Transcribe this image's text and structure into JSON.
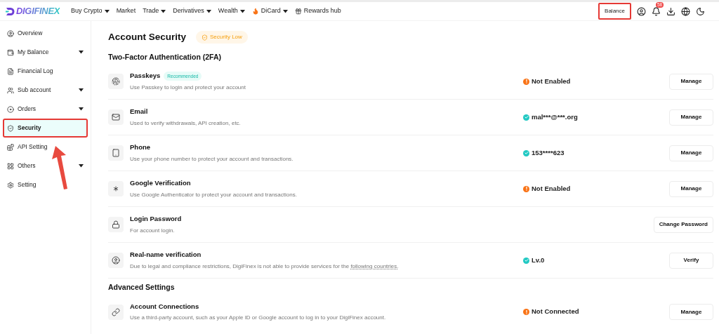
{
  "header": {
    "logo": "DIGIFINEX",
    "nav": [
      {
        "label": "Buy Crypto",
        "dropdown": true,
        "kind": "plain"
      },
      {
        "label": "Market",
        "dropdown": false,
        "kind": "plain"
      },
      {
        "label": "Trade",
        "dropdown": true,
        "kind": "plain"
      },
      {
        "label": "Derivatives",
        "dropdown": true,
        "kind": "plain"
      },
      {
        "label": "Wealth",
        "dropdown": true,
        "kind": "plain"
      },
      {
        "label": "DiCard",
        "dropdown": true,
        "kind": "flame"
      },
      {
        "label": "Rewards hub",
        "dropdown": false,
        "kind": "gift"
      }
    ],
    "balance": {
      "label": "Balance",
      "annotated": true
    },
    "notification_count": "58"
  },
  "sidebar": {
    "items": [
      {
        "label": "Overview",
        "kind": "user",
        "dropdown": false,
        "selected": false,
        "annotated": false
      },
      {
        "label": "My Balance",
        "kind": "wallet",
        "dropdown": true,
        "selected": false,
        "annotated": false
      },
      {
        "label": "Financial Log",
        "kind": "file",
        "dropdown": false,
        "selected": false,
        "annotated": false
      },
      {
        "label": "Sub account",
        "kind": "users",
        "dropdown": true,
        "selected": false,
        "annotated": false
      },
      {
        "label": "Orders",
        "kind": "orders",
        "dropdown": true,
        "selected": false,
        "annotated": false
      },
      {
        "label": "Security",
        "kind": "shield",
        "dropdown": false,
        "selected": true,
        "annotated": true
      },
      {
        "label": "API Setting",
        "kind": "api",
        "dropdown": false,
        "selected": false,
        "annotated": false
      },
      {
        "label": "Others",
        "kind": "grid",
        "dropdown": true,
        "selected": false,
        "annotated": false
      },
      {
        "label": "Setting",
        "kind": "setting",
        "dropdown": false,
        "selected": false,
        "annotated": false
      }
    ]
  },
  "main": {
    "title": "Account Security",
    "security_badge": "Security Low",
    "sections": [
      {
        "heading": "Two-Factor Authentication (2FA)",
        "items": [
          {
            "kind": "passkey",
            "title": "Passkeys",
            "tag": "Recommended",
            "description": "Use Passkey to login and protect your account",
            "status": {
              "kind": "warning",
              "text": "Not Enabled"
            },
            "button": "Manage"
          },
          {
            "kind": "mail",
            "title": "Email",
            "description": "Used to verify withdrawals, API creation, etc.",
            "status": {
              "kind": "ok",
              "text": "mal***@***.org"
            },
            "button": "Manage"
          },
          {
            "kind": "phone",
            "title": "Phone",
            "description": "Use your phone number to protect your account and transactions.",
            "status": {
              "kind": "ok",
              "text": "153****623"
            },
            "button": "Manage"
          },
          {
            "kind": "asterisk",
            "title": "Google Verification",
            "description": "Use Google Authenticator to protect your account and transactions.",
            "status": {
              "kind": "warning",
              "text": "Not Enabled"
            },
            "button": "Manage"
          },
          {
            "kind": "lock",
            "title": "Login Password",
            "description": "For account login.",
            "button": "Change Password"
          },
          {
            "kind": "user",
            "title": "Real-name verification",
            "description": "Due to legal and compliance restrictions, DigiFinex is not able to provide services for the",
            "link": "following countries.",
            "status": {
              "kind": "ok",
              "text": "Lv.0"
            },
            "button": "Verify"
          }
        ]
      },
      {
        "heading": "Advanced Settings",
        "items": [
          {
            "kind": "link",
            "title": "Account Connections",
            "description": "Use a third-party account, such as your Apple ID or Google account to log in to your DigiFinex account.",
            "status": {
              "kind": "warning",
              "text": "Not Connected"
            },
            "button": "Manage"
          }
        ]
      }
    ]
  }
}
